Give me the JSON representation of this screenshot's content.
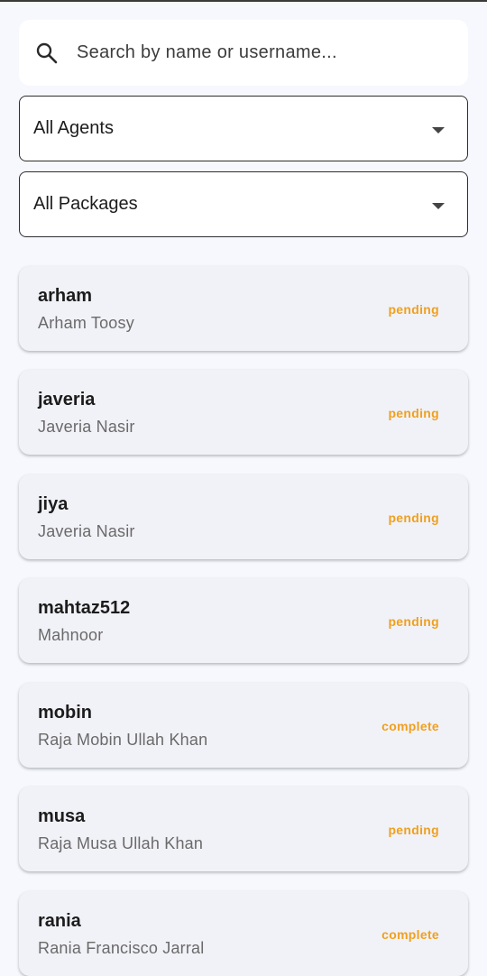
{
  "search": {
    "placeholder": "Search by name or username...",
    "icon": "search-icon"
  },
  "filters": {
    "agent": {
      "selected": "All Agents"
    },
    "package": {
      "selected": "All Packages"
    }
  },
  "colors": {
    "pending": "#f0a020",
    "complete": "#f0a020",
    "card_bg": "#f1f2f7",
    "page_bg": "#f6f8fd"
  },
  "customers": [
    {
      "username": "arham",
      "name": "Arham Toosy",
      "status": "pending"
    },
    {
      "username": "javeria",
      "name": "Javeria Nasir",
      "status": "pending"
    },
    {
      "username": "jiya",
      "name": "Javeria Nasir",
      "status": "pending"
    },
    {
      "username": "mahtaz512",
      "name": "Mahnoor",
      "status": "pending"
    },
    {
      "username": "mobin",
      "name": "Raja Mobin Ullah Khan",
      "status": "complete"
    },
    {
      "username": "musa",
      "name": "Raja Musa Ullah Khan",
      "status": "pending"
    },
    {
      "username": "rania",
      "name": "Rania Francisco Jarral",
      "status": "complete"
    }
  ]
}
